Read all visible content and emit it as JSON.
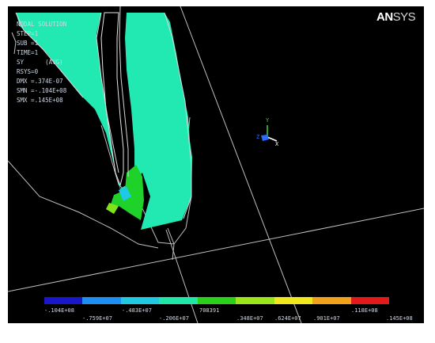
{
  "app": {
    "logo_bold": "AN",
    "logo_rest": "SYS"
  },
  "info_lines": [
    "NODAL SOLUTION",
    "STEP=1",
    "SUB =1",
    "TIME=1",
    "SY      (AVG)",
    "RSYS=0",
    "DMX =.374E-07",
    "SMN =-.104E+08",
    "SMX =.145E+08"
  ],
  "triad": {
    "y_label": "Y",
    "z_label": "Z",
    "x_label": "X"
  },
  "legend": {
    "colors": [
      "#1a16c9",
      "#1e8ff2",
      "#20c9df",
      "#20e6a8",
      "#2ad01a",
      "#9be61a",
      "#f0e81c",
      "#f2a21a",
      "#e21a1a"
    ],
    "labels_top": [
      "-.104E+08",
      "-.483E+07",
      "708391",
      ".118E+08"
    ],
    "labels_bottom": [
      "-.759E+07",
      "-.206E+07",
      ".348E+07",
      ".624E+07",
      ".901E+07",
      ".145E+08"
    ]
  }
}
